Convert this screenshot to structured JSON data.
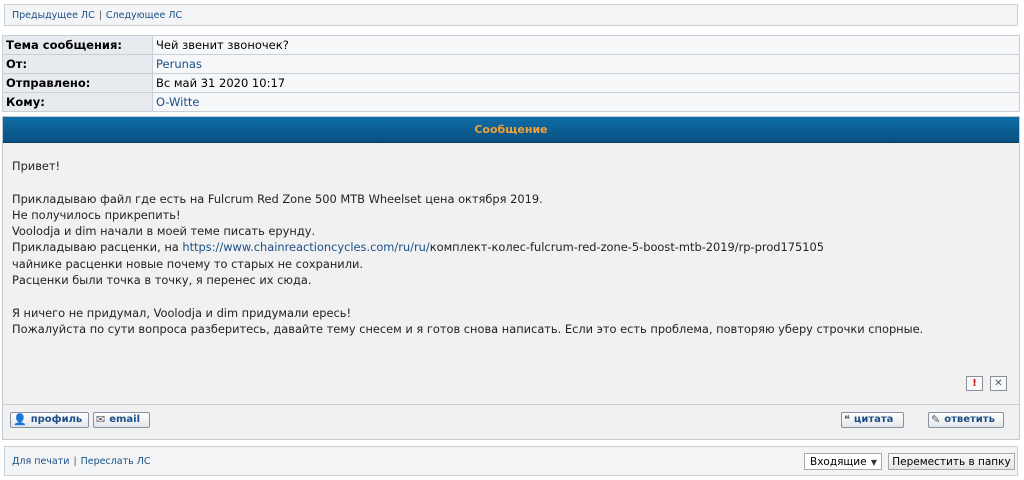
{
  "nav": {
    "prev": "Предыдущее ЛС",
    "next": "Следующее ЛС",
    "separator": "|"
  },
  "meta": [
    {
      "label": "Тема сообщения:",
      "value": "Чей звенит звоночек?"
    },
    {
      "label": "От:",
      "value": "Perunas"
    },
    {
      "label": "Отправлено:",
      "value": "Вс май 31 2020 10:17"
    },
    {
      "label": "Кому:",
      "value": "O-Witte"
    }
  ],
  "message": {
    "header": "Сообщение",
    "greeting": "Привет!",
    "line1": "Прикладываю файл где есть на Fulcrum Red Zone 500 MTB Wheelset цена октября 2019.",
    "line2": "Не получилось прикрепить!",
    "line3": "Voolodja и dim начали в моей теме писать ерунду.",
    "line4_prefix": "Прикладываю расценки, на ",
    "line4_link": "https://www.chainreactioncycles.com/ru/ru/",
    "line4_suffix": "комплект-колес-fulcrum-red-zone-5-boost-mtb-2019/rp-prod175105",
    "line5": "чайнике расценки новые почему то старых не сохранили.",
    "line6": "Расценки были точка в точку, я перенес их сюда.",
    "line7": "Я ничего не придумал, Voolodja и dim придумали ересь!",
    "line8": "Пожалуйста по сути вопроса разберитесь, давайте тему снесем и я готов снова написать. Если это есть проблема, повторяю уберу строчки спорные."
  },
  "icons": {
    "report": "!",
    "delete": "✕"
  },
  "buttons": {
    "profile": "профиль",
    "email": "email",
    "quote": "цитата",
    "reply": "ответить"
  },
  "bottom": {
    "print": "Для печати",
    "forward": "Переслать ЛС",
    "folder_select": "Входящие",
    "move_button": "Переместить в папку"
  }
}
